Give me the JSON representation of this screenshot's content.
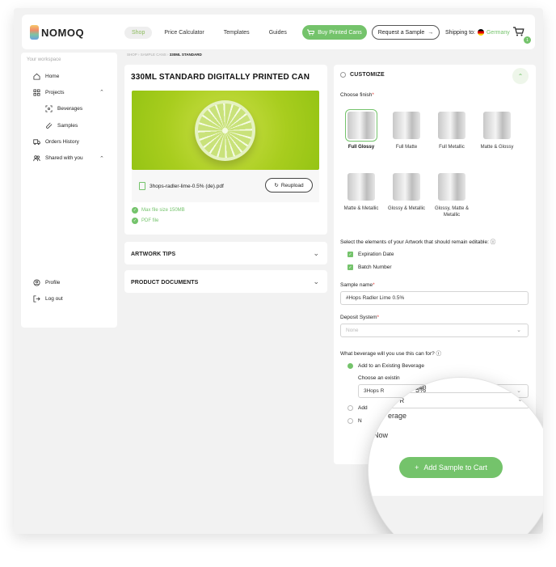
{
  "brand": {
    "name": "NOMOQ"
  },
  "nav": {
    "items": [
      "Shop",
      "Price Calculator",
      "Templates",
      "Guides"
    ],
    "active": "Shop"
  },
  "header": {
    "buy_label": "Buy Printed Cans",
    "sample_label": "Request a Sample",
    "ship_label": "Shipping to:",
    "country": "Germany",
    "cart_count": "1"
  },
  "sidebar": {
    "title": "Your workspace",
    "items": [
      "Home",
      "Projects",
      "Beverages",
      "Samples",
      "Orders History",
      "Shared with you"
    ],
    "bottom": [
      "Profile",
      "Log out"
    ]
  },
  "breadcrumb": {
    "a": "SHOP",
    "b": "SAMPLE CANS",
    "c": "330ML STANDARD"
  },
  "product": {
    "title": "330ML STANDARD DIGITALLY PRINTED CAN",
    "file_name": "3hops-radler-lime-0.5% (de).pdf",
    "reupload_label": "Reupload",
    "checks": [
      "Max file size 150MB",
      "PDF file"
    ]
  },
  "accordions": [
    "ARTWORK TIPS",
    "PRODUCT DOCUMENTS"
  ],
  "customize": {
    "title": "CUSTOMIZE",
    "finish_label": "Choose finish",
    "finishes": [
      "Full Glossy",
      "Full Matte",
      "Full Metallic",
      "Matte & Glossy",
      "Matte & Metallic",
      "Glossy & Metallic",
      "Glossy, Matte & Metallic"
    ],
    "selected_finish": "Full Glossy",
    "editable_label": "Select the elements of your Artwork that should remain editable:",
    "editable_items": [
      "Expiration Date",
      "Batch Number"
    ],
    "sample_name_label": "Sample name",
    "sample_name_value": "#Hops Radler Lime 0.5%",
    "deposit_label": "Deposit System",
    "deposit_placeholder": "None",
    "beverage_label": "What beverage will you use this can for?",
    "beverage_option_1": "Add to an Existing Beverage",
    "choose_existing_label": "Choose an existin",
    "existing_value": "3Hops R",
    "radio_2": "Add",
    "radio_3": "N"
  },
  "magnifier": {
    "overlap_text": "5%",
    "choose_existing": "Choose an existin",
    "field_value": "3Hops R",
    "line_2a": "Ad",
    "line_2b": "erage",
    "line_3": "Now",
    "button_label": "Add Sample to Cart"
  },
  "colors": {
    "accent": "#74c36b",
    "background": "#f2f2f2"
  }
}
